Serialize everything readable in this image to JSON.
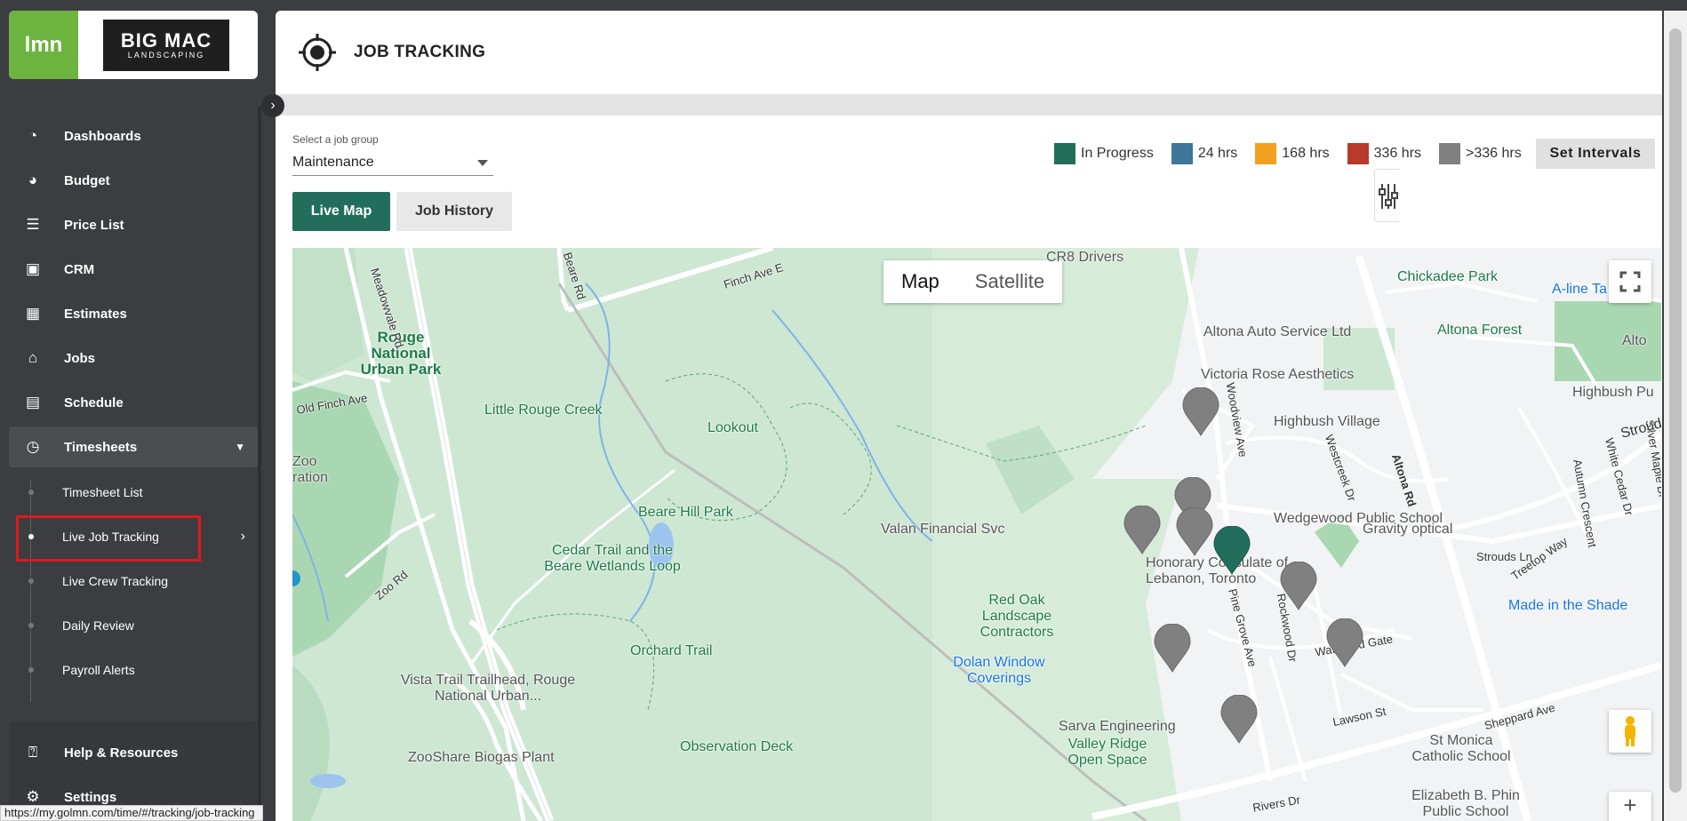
{
  "brand": {
    "lmn": "lmn",
    "company_line1": "BIG MAC",
    "company_line2": "LANDSCAPING"
  },
  "sidebar": {
    "items": [
      {
        "label": "Dashboards",
        "icon": "dashboard-icon"
      },
      {
        "label": "Budget",
        "icon": "pie-chart-icon"
      },
      {
        "label": "Price List",
        "icon": "list-icon"
      },
      {
        "label": "CRM",
        "icon": "contact-card-icon"
      },
      {
        "label": "Estimates",
        "icon": "calculator-icon"
      },
      {
        "label": "Jobs",
        "icon": "jobs-icon"
      },
      {
        "label": "Schedule",
        "icon": "calendar-icon"
      },
      {
        "label": "Timesheets",
        "icon": "clock-icon"
      }
    ],
    "timesheet_sub": [
      {
        "label": "Timesheet List"
      },
      {
        "label": "Live Job Tracking"
      },
      {
        "label": "Live Crew Tracking"
      },
      {
        "label": "Daily Review"
      },
      {
        "label": "Payroll Alerts"
      }
    ],
    "bottom": [
      {
        "label": "Help & Resources",
        "icon": "help-icon"
      },
      {
        "label": "Settings",
        "icon": "gear-icon"
      }
    ]
  },
  "status_url": "https://my.golmn.com/time/#/tracking/job-tracking",
  "header": {
    "title": "JOB TRACKING"
  },
  "job_group": {
    "label": "Select a job group",
    "value": "Maintenance"
  },
  "legend": [
    {
      "label": "In Progress",
      "color": "#236e5b"
    },
    {
      "label": "24 hrs",
      "color": "#3f7699"
    },
    {
      "label": "168 hrs",
      "color": "#f2a11f"
    },
    {
      "label": "336 hrs",
      "color": "#b83a2b"
    },
    {
      "label": ">336 hrs",
      "color": "#808080"
    }
  ],
  "set_intervals": "Set Intervals",
  "tabs": {
    "live": "Live Map",
    "history": "Job History"
  },
  "map": {
    "type_map": "Map",
    "type_satellite": "Satellite",
    "places": [
      "Chickadee Park",
      "A-line Ta",
      "Altona Auto Service Ltd",
      "Altona Forest",
      "Victoria Rose Aesthetics",
      "Highbush Village",
      "Highbush Pu",
      "Alto",
      "Little Rouge Creek",
      "Lookout",
      "Beare Hill Park",
      "Cedar Trail and the Beare Wetlands Loop",
      "Valan Financial Svc",
      "Gravity optical",
      "Red Oak Landscape Contractors",
      "Dolan Window Coverings",
      "Made in the Shade",
      "Orchard Trail",
      "Vista Trail Trailhead, Rouge National Urban...",
      "Observation Deck",
      "ZooShare Biogas Plant",
      "Sarva Engineering",
      "Valley Ridge Open Space",
      "St Monica Catholic School",
      "Elizabeth B. Phin Public School",
      "Rouge National Urban Park",
      "Zoo ration",
      "CR8 Drivers",
      "Honorary Consulate of Lebanon, Toronto",
      "Wedgewood Public School"
    ],
    "roads": [
      "Meadowvale Rd",
      "Beare Rd",
      "Finch Ave E",
      "Old Finch Ave",
      "Zoo Rd",
      "Altona Rd",
      "Strouds Ln",
      "Sheppard Ave",
      "Waterford Gate",
      "Lawson St",
      "Pine Grove Ave",
      "Rockwood Dr",
      "Westcreek Dr",
      "Treetop Way",
      "Autumn Crescent",
      "White Cedar Dr",
      "Silver Maple Dr",
      "Strouds",
      "Woodview Ave",
      "Rivers Dr"
    ],
    "markers": [
      {
        "status": ">336 hrs",
        "color": "#808080"
      },
      {
        "status": ">336 hrs",
        "color": "#808080"
      },
      {
        "status": ">336 hrs",
        "color": "#808080"
      },
      {
        "status": ">336 hrs",
        "color": "#808080"
      },
      {
        "status": "In Progress",
        "color": "#236e5b"
      },
      {
        "status": ">336 hrs",
        "color": "#808080"
      },
      {
        "status": ">336 hrs",
        "color": "#808080"
      },
      {
        "status": ">336 hrs",
        "color": "#808080"
      },
      {
        "status": ">336 hrs",
        "color": "#808080"
      }
    ]
  }
}
